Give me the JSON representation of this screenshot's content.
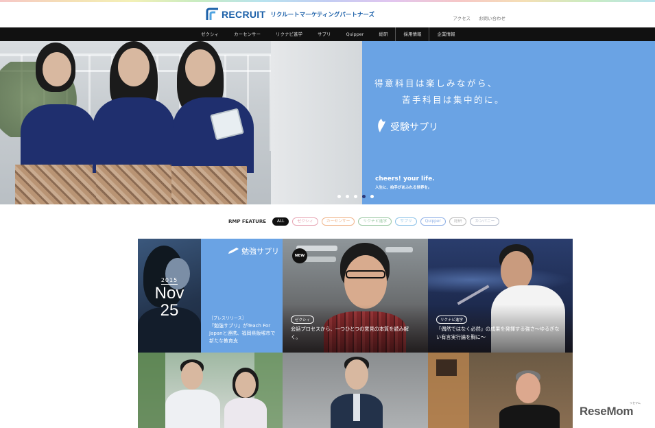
{
  "header": {
    "logo_word": "RECRUIT",
    "logo_sub": "リクルートマーケティングパートナーズ",
    "util_links": [
      "アクセス",
      "お問い合わせ"
    ]
  },
  "nav": {
    "items": [
      "ゼクシィ",
      "カーセンサー",
      "リクナビ進学",
      "サプリ",
      "Quipper",
      "総研",
      "採用情報",
      "企業情報"
    ]
  },
  "hero": {
    "copy_line1": "得意科目は楽しみながら、",
    "copy_line2": "苦手科目は集中的に。",
    "brand": "受験サプリ",
    "tagline": "cheers! your life.",
    "tagline_sub": "人生に、拍手があふれる世界を。",
    "dots": 5,
    "active_dot": 3
  },
  "filter": {
    "label": "RMP FEATURE",
    "chips": [
      {
        "label": "ALL",
        "color": "#111111"
      },
      {
        "label": "ゼクシィ",
        "color": "#e7a7b5"
      },
      {
        "label": "カーセンサー",
        "color": "#f0b48a"
      },
      {
        "label": "リクナビ進学",
        "color": "#9cc9a4"
      },
      {
        "label": "サプリ",
        "color": "#8ec3e8"
      },
      {
        "label": "Quipper",
        "color": "#8fb0e6"
      },
      {
        "label": "総研",
        "color": "#b9b9b9"
      },
      {
        "label": "カンパニー",
        "color": "#b0b8c8"
      }
    ]
  },
  "tiles": {
    "news": {
      "year": "2015",
      "month": "Nov",
      "day": "25",
      "brand": "勉強サプリ",
      "kind": "［プレスリリース］",
      "text": "『勉強サプリ』がTeach For Japanと連携、福岡県飯塚市で新たな教育支"
    },
    "zexy": {
      "badge": "NEW",
      "category": "ゼクシィ",
      "text": "会話プロセスから、一つひとつの意見の本質を読み解く。"
    },
    "rikunabi": {
      "category": "リクナビ進学",
      "text": "「偶然ではなく必然」の成果を発揮する強さ～ゆるぎない有言実行論を胸に～"
    }
  },
  "watermark": {
    "text": "ReseMom",
    "sub": "リセマム"
  }
}
